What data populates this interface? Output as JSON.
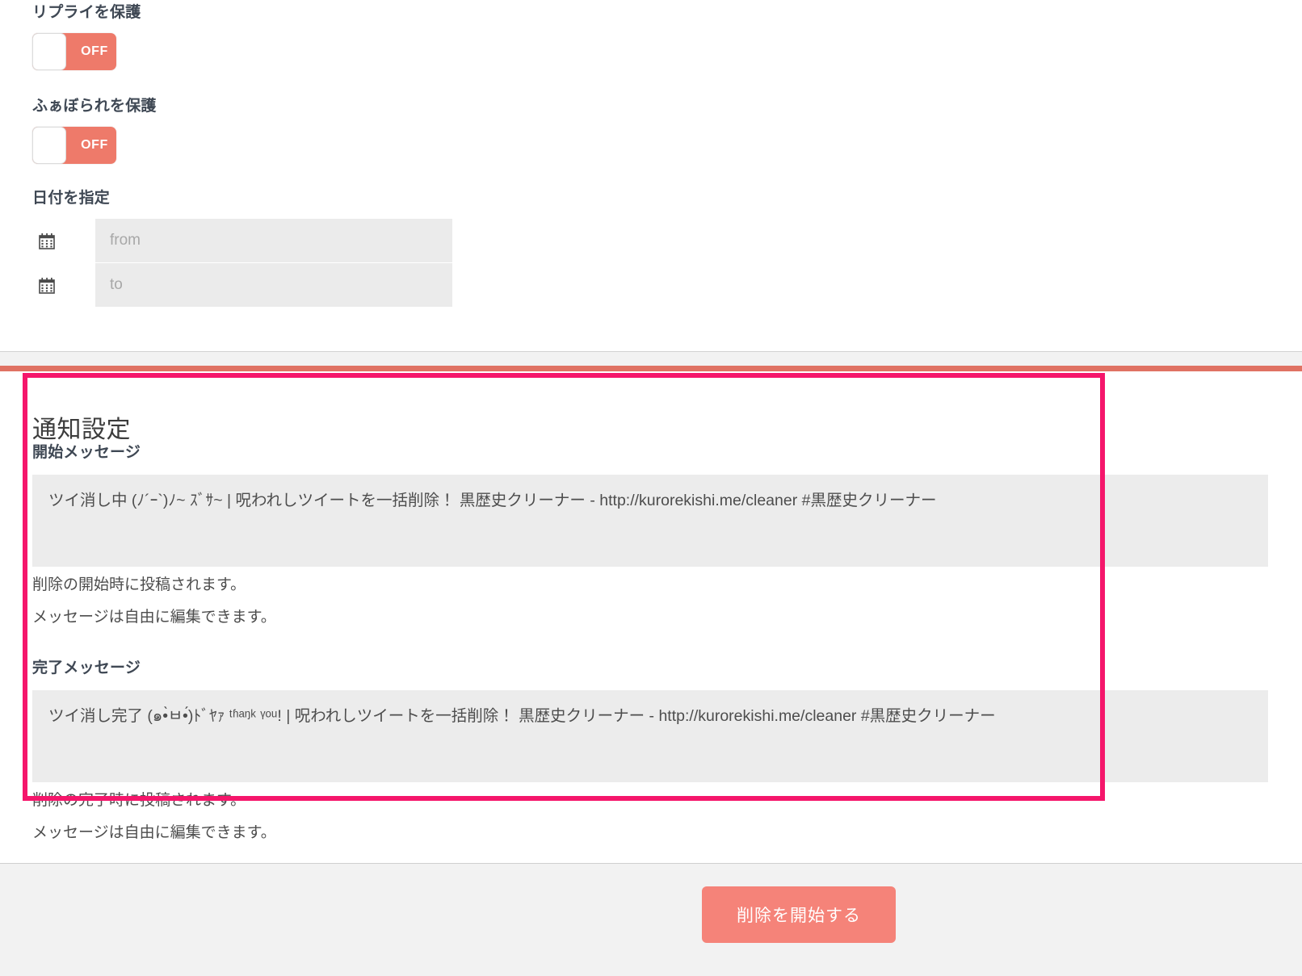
{
  "form": {
    "protect_replies": {
      "label": "リプライを保護",
      "toggle_state": "OFF",
      "toggle_on": false
    },
    "protect_favorites": {
      "label": "ふぁぼられを保護",
      "toggle_state": "OFF",
      "toggle_on": false
    },
    "date_range": {
      "label": "日付を指定",
      "from": {
        "value": "",
        "placeholder": "from",
        "icon": "calendar-icon"
      },
      "to": {
        "value": "",
        "placeholder": "to",
        "icon": "calendar-icon"
      }
    }
  },
  "notification_settings": {
    "title": "通知設定",
    "start_message": {
      "label": "開始メッセージ",
      "value": "ツイ消し中 (ﾉ´ｰ`)ﾉ~ ｽﾞｻ~ | 呪われしツイートを一括削除！ 黒歴史クリーナー - http://kurorekishi.me/cleaner #黒歴史クリーナー",
      "hint_line1": "削除の開始時に投稿されます。",
      "hint_line2": "メッセージは自由に編集できます。"
    },
    "complete_message": {
      "label": "完了メッセージ",
      "value": "ツイ消し完了 (๑•̀ㅂ•́)ﾄﾞﾔｧ ᵗʱᵃᵑᵏ ᵞᵒᵘ! | 呪われしツイートを一括削除！ 黒歴史クリーナー - http://kurorekishi.me/cleaner #黒歴史クリーナー",
      "hint_line1": "削除の完了時に投稿されます。",
      "hint_line2": "メッセージは自由に編集できます。"
    }
  },
  "footer": {
    "start_delete_label": "削除を開始する"
  },
  "colors": {
    "toggle_off_track": "#ee7a6a",
    "accent_bar": "#e07263",
    "highlight_border": "#f5166b",
    "primary_button": "#f58379",
    "input_background": "#ebebeb",
    "textarea_background": "#ececec",
    "footer_background": "#f2f2f2"
  }
}
